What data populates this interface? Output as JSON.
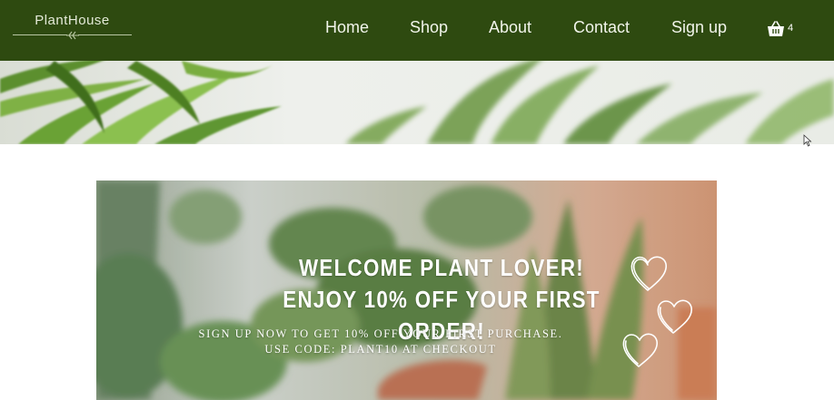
{
  "brand": {
    "name": "PlantHouse"
  },
  "nav": {
    "items": [
      {
        "label": "Home"
      },
      {
        "label": "Shop"
      },
      {
        "label": "About"
      },
      {
        "label": "Contact"
      },
      {
        "label": "Sign up"
      }
    ],
    "cart": {
      "icon": "basket-icon",
      "count": "4"
    }
  },
  "promo": {
    "title": "WELCOME PLANT LOVER! ENJOY 10% OFF YOUR FIRST ORDER!",
    "subtitle_line1": "SIGN UP NOW TO GET 10% OFF YOUR FIRST PURCHASE.",
    "subtitle_line2": "USE CODE: PLANT10 AT CHECKOUT",
    "decoration": "hearts-icon"
  },
  "colors": {
    "nav_bg": "#2e4a10",
    "nav_text": "#f1f4ea",
    "page_bg": "#ffffff"
  }
}
